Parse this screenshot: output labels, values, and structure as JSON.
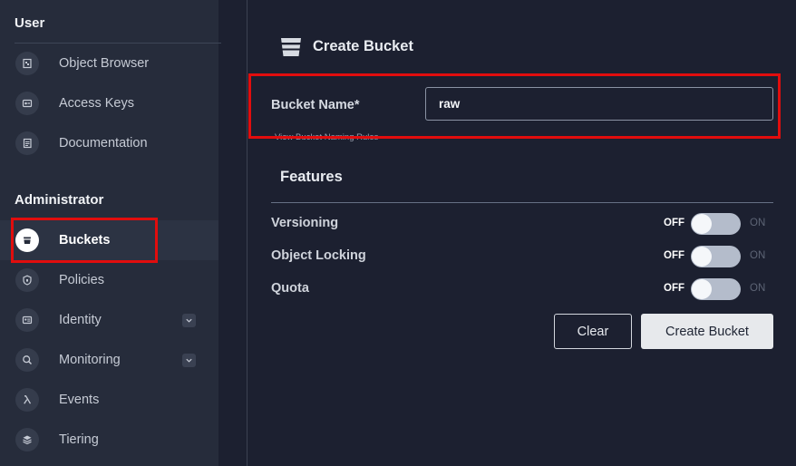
{
  "sidebar": {
    "user_section": "User",
    "admin_section": "Administrator",
    "user_items": [
      {
        "label": "Object Browser",
        "icon": "object-browser-icon"
      },
      {
        "label": "Access Keys",
        "icon": "access-keys-icon"
      },
      {
        "label": "Documentation",
        "icon": "documentation-icon"
      }
    ],
    "admin_items": [
      {
        "label": "Buckets",
        "icon": "bucket-icon",
        "active": true
      },
      {
        "label": "Policies",
        "icon": "shield-icon"
      },
      {
        "label": "Identity",
        "icon": "identity-icon",
        "expandable": true
      },
      {
        "label": "Monitoring",
        "icon": "monitoring-icon",
        "expandable": true
      },
      {
        "label": "Events",
        "icon": "lambda-icon"
      },
      {
        "label": "Tiering",
        "icon": "tiering-icon"
      }
    ]
  },
  "main": {
    "title": "Create Bucket",
    "bucket_name_label": "Bucket Name*",
    "bucket_name_value": "raw",
    "naming_rules_link": "View Bucket Naming Rules",
    "features_title": "Features",
    "features": [
      {
        "label": "Versioning",
        "off": "OFF",
        "on": "ON",
        "enabled": false
      },
      {
        "label": "Object Locking",
        "off": "OFF",
        "on": "ON",
        "enabled": false
      },
      {
        "label": "Quota",
        "off": "OFF",
        "on": "ON",
        "enabled": false
      }
    ],
    "clear_button": "Clear",
    "create_button": "Create Bucket"
  },
  "colors": {
    "sidebar_bg": "#262c3b",
    "main_bg": "#1c2030",
    "highlight": "#e10d0d",
    "toggle_track": "#b4bccb"
  }
}
